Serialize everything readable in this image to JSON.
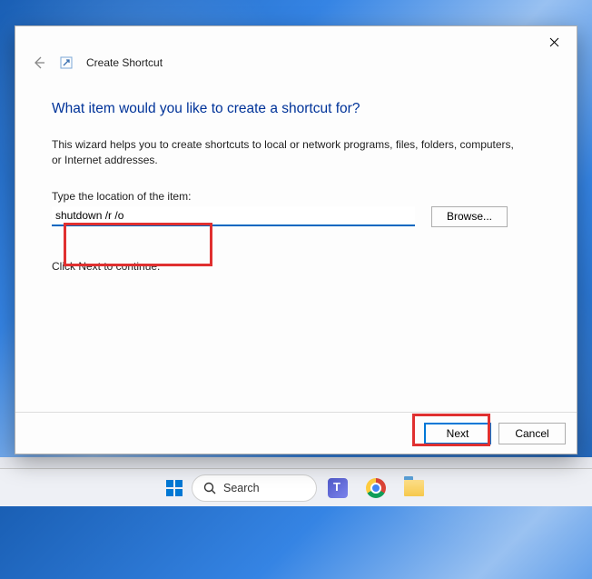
{
  "window": {
    "title": "Create Shortcut",
    "close_tooltip": "Close"
  },
  "wizard": {
    "headline": "What item would you like to create a shortcut for?",
    "description": "This wizard helps you to create shortcuts to local or network programs, files, folders, computers, or Internet addresses.",
    "location_label": "Type the location of the item:",
    "location_value": "shutdown /r /o",
    "browse_label": "Browse...",
    "continue_hint": "Click Next to continue."
  },
  "footer": {
    "next_label": "Next",
    "cancel_label": "Cancel"
  },
  "taskbar": {
    "search_placeholder": "Search"
  }
}
